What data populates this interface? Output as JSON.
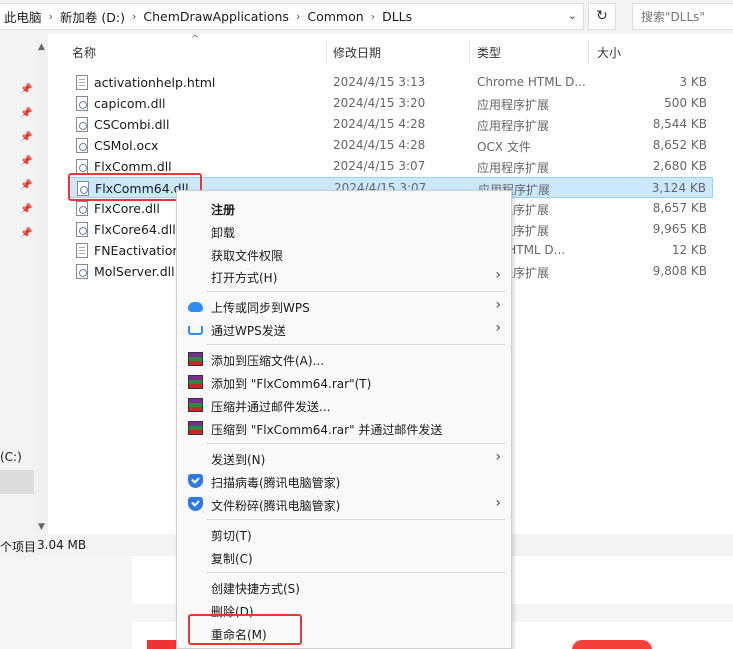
{
  "address": {
    "crumbs": [
      "此电脑",
      "新加卷 (D:)",
      "ChemDrawApplications",
      "Common",
      "DLLs"
    ],
    "separator": "›",
    "dropdown_icon": "chevron-down-icon",
    "refresh_icon": "↻"
  },
  "search": {
    "placeholder": "搜索\"DLLs\""
  },
  "nav": {
    "drive_label": "(C:)",
    "pin_icon": "📌"
  },
  "columns": {
    "name": "名称",
    "date": "修改日期",
    "type": "类型",
    "size": "大小",
    "sort_indicator": "^"
  },
  "files": [
    {
      "name": "activationhelp.html",
      "date": "2024/4/15 3:13",
      "type": "Chrome HTML D...",
      "size": "3 KB",
      "icon": "html"
    },
    {
      "name": "capicom.dll",
      "date": "2024/4/15 3:20",
      "type": "应用程序扩展",
      "size": "500 KB",
      "icon": "dll"
    },
    {
      "name": "CSCombi.dll",
      "date": "2024/4/15 4:28",
      "type": "应用程序扩展",
      "size": "8,544 KB",
      "icon": "dll"
    },
    {
      "name": "CSMol.ocx",
      "date": "2024/4/15 4:28",
      "type": "OCX 文件",
      "size": "8,652 KB",
      "icon": "dll"
    },
    {
      "name": "FlxComm.dll",
      "date": "2024/4/15 3:07",
      "type": "应用程序扩展",
      "size": "2,680 KB",
      "icon": "dll"
    },
    {
      "name": "FlxComm64.dll",
      "date": "2024/4/15 3:07",
      "type": "应用程序扩展",
      "size": "3,124 KB",
      "icon": "dll"
    },
    {
      "name": "FlxCore.dll",
      "date": "",
      "type": "应用程序扩展",
      "size": "8,657 KB",
      "icon": "dll"
    },
    {
      "name": "FlxCore64.dll",
      "date": "",
      "type": "应用程序扩展",
      "size": "9,965 KB",
      "icon": "dll"
    },
    {
      "name": "FNEactivationh",
      "date": "",
      "type": "ome HTML D...",
      "size": "12 KB",
      "icon": "html"
    },
    {
      "name": "MolServer.dll",
      "date": "",
      "type": "应用程序扩展",
      "size": "9,808 KB",
      "icon": "dll"
    }
  ],
  "status": {
    "items": "个项目",
    "selected_size": "3.04 MB"
  },
  "menu": {
    "items": [
      {
        "label": "注册",
        "bold": true
      },
      {
        "label": "卸载"
      },
      {
        "label": "获取文件权限"
      },
      {
        "label": "打开方式(H)",
        "submenu": true
      },
      {
        "label": "上传或同步到WPS",
        "submenu": true,
        "icon": "cloud"
      },
      {
        "label": "通过WPS发送",
        "submenu": true,
        "icon": "share"
      },
      {
        "label": "添加到压缩文件(A)...",
        "icon": "rar"
      },
      {
        "label": "添加到 \"FlxComm64.rar\"(T)",
        "icon": "rar"
      },
      {
        "label": "压缩并通过邮件发送...",
        "icon": "rar"
      },
      {
        "label": "压缩到 \"FlxComm64.rar\" 并通过邮件发送",
        "icon": "rar"
      },
      {
        "label": "发送到(N)",
        "submenu": true
      },
      {
        "label": "扫描病毒(腾讯电脑管家)",
        "icon": "shield"
      },
      {
        "label": "文件粉碎(腾讯电脑管家)",
        "submenu": true,
        "icon": "shield"
      },
      {
        "label": "剪切(T)"
      },
      {
        "label": "复制(C)"
      },
      {
        "label": "创建快捷方式(S)"
      },
      {
        "label": "删除(D)"
      },
      {
        "label": "重命名(M)"
      }
    ],
    "submenu_arrow": "›"
  },
  "colors": {
    "selection": "#cce8ff",
    "highlight": "#e53935",
    "wps_blue": "#2f8cf0"
  }
}
